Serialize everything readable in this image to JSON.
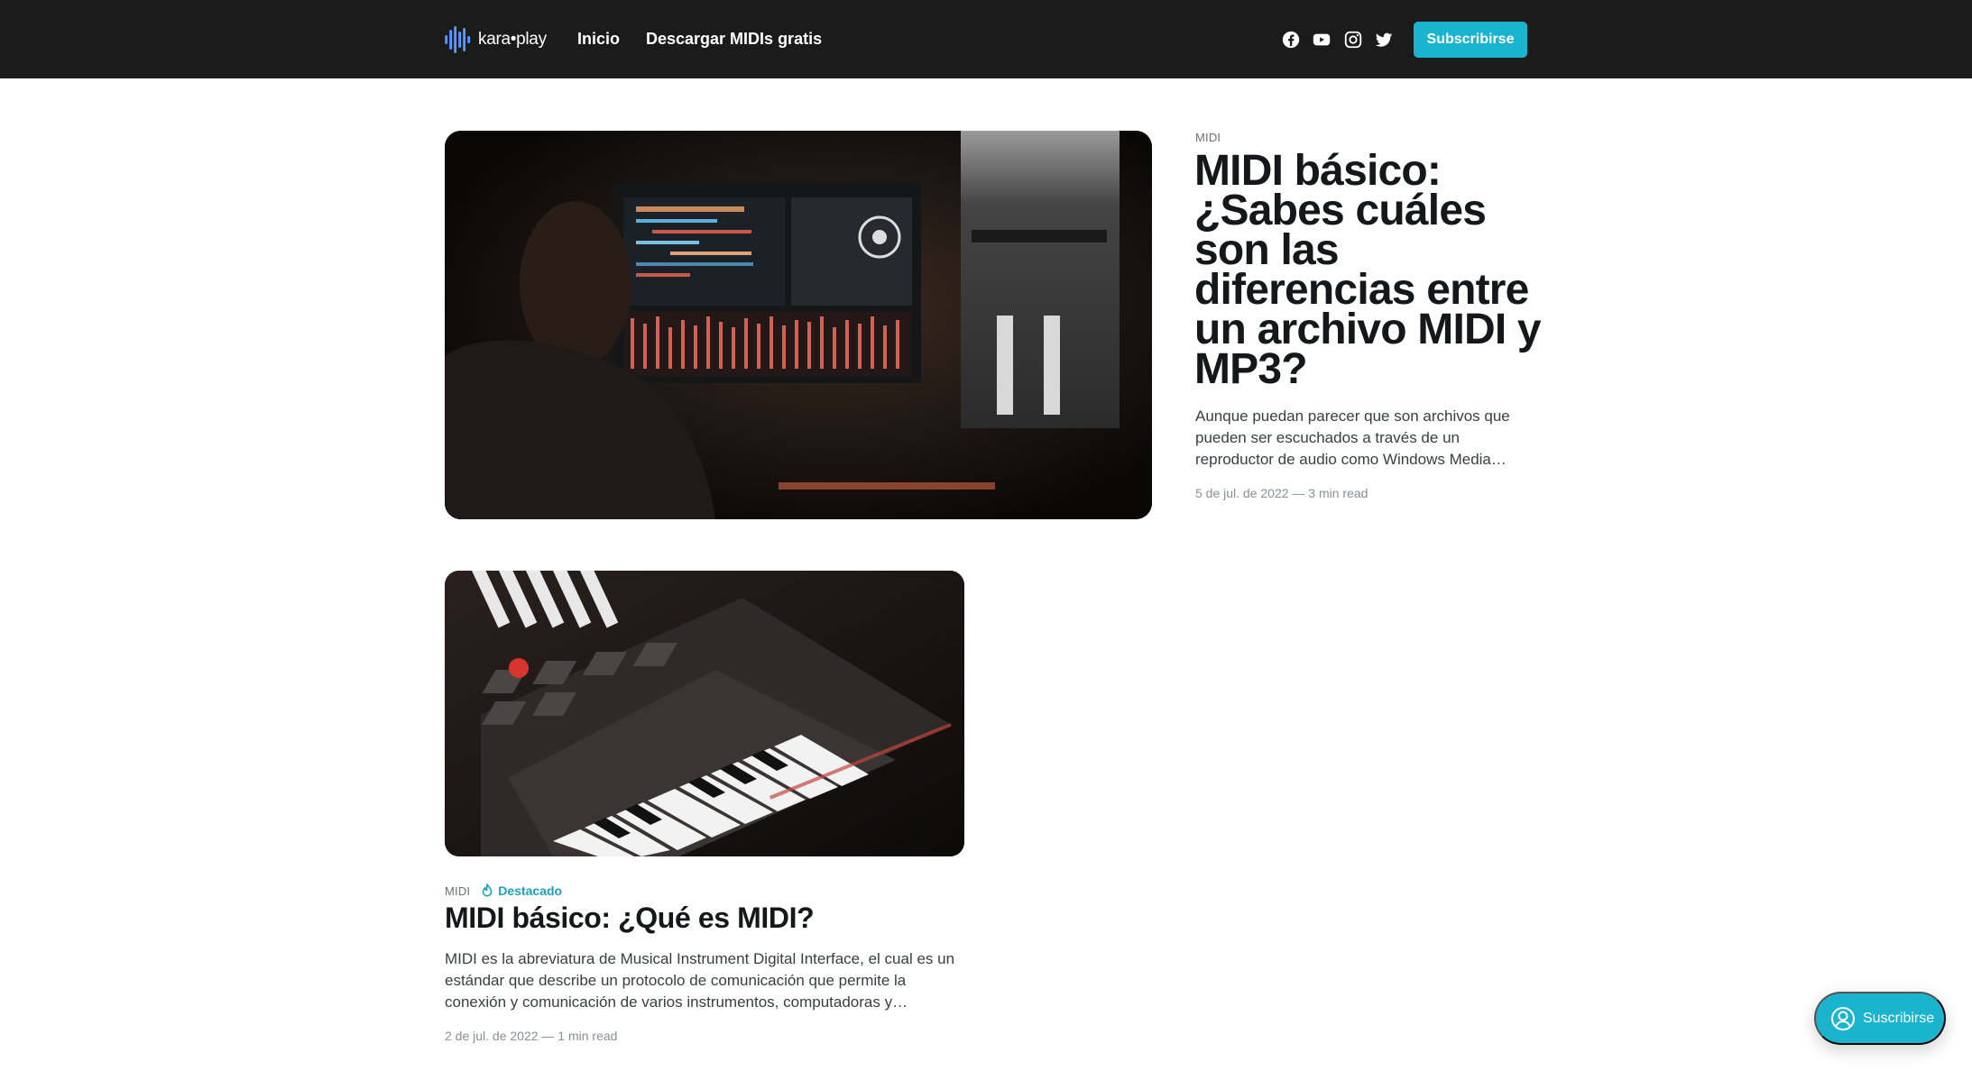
{
  "header": {
    "brand": "kara•play",
    "nav": [
      {
        "label": "Inicio"
      },
      {
        "label": "Descargar MIDIs gratis"
      }
    ],
    "social_icons": [
      "facebook-icon",
      "youtube-icon",
      "instagram-icon",
      "twitter-icon"
    ],
    "subscribe_label": "Subscribirse"
  },
  "posts": [
    {
      "tag": "MIDI",
      "title": "MIDI básico: ¿Sabes cuáles son las diferencias entre un archivo MIDI y MP3?",
      "excerpt": "Aunque puedan parecer que son archivos que pueden ser escuchados a través de un reproductor de audio como Windows Media…",
      "meta": "5 de jul. de 2022 — 3 min read",
      "image": "music-producer-at-daw-screen"
    },
    {
      "tag": "MIDI",
      "featured_label": "Destacado",
      "title": "MIDI básico: ¿Qué es MIDI?",
      "excerpt": "MIDI es la abreviatura de Musical Instrument Digital Interface, el cual es un estándar que describe un protocolo de comunicación que permite la conexión y comunicación de varios instrumentos, computadoras y…",
      "meta": "2 de jul. de 2022 — 1 min read",
      "image": "midi-keyboard-controller"
    }
  ],
  "portal": {
    "label": "Suscribirse",
    "icon": "user-icon"
  },
  "colors": {
    "header_bg": "#1b1b1b",
    "accent": "#1ab4cf",
    "text": "#15171a",
    "muted": "#8a8f96"
  }
}
